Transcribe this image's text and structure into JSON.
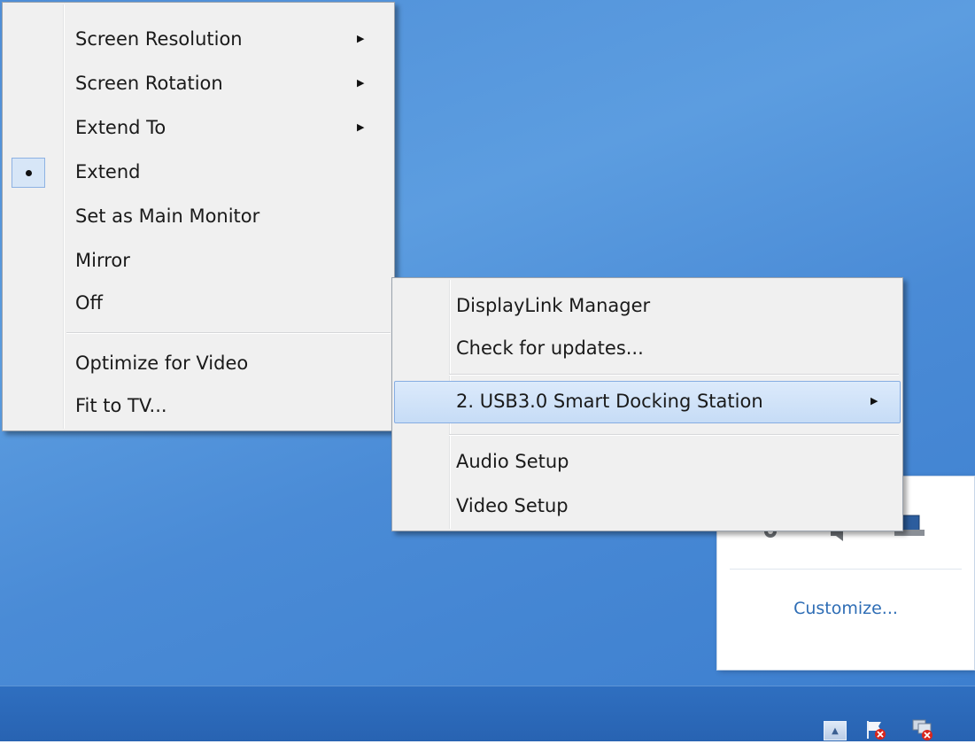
{
  "submenu": {
    "items": [
      {
        "label": "Screen Resolution",
        "has_submenu": true
      },
      {
        "label": "Screen Rotation",
        "has_submenu": true
      },
      {
        "label": "Extend To",
        "has_submenu": true
      },
      {
        "label": "Extend",
        "checked": true
      },
      {
        "label": "Set as Main Monitor"
      },
      {
        "label": "Mirror"
      },
      {
        "label": "Off"
      },
      {
        "label": "Optimize for Video"
      },
      {
        "label": "Fit to TV..."
      }
    ]
  },
  "main_menu": {
    "items": [
      {
        "label": "DisplayLink Manager"
      },
      {
        "label": "Check for updates..."
      },
      {
        "label": "2. USB3.0 Smart Docking Station",
        "has_submenu": true,
        "highlighted": true
      },
      {
        "label": "Audio Setup"
      },
      {
        "label": "Video Setup"
      }
    ]
  },
  "overflow_panel": {
    "customize_label": "Customize..."
  },
  "icons": {
    "arrow": "▶",
    "tray_up": "▲"
  }
}
